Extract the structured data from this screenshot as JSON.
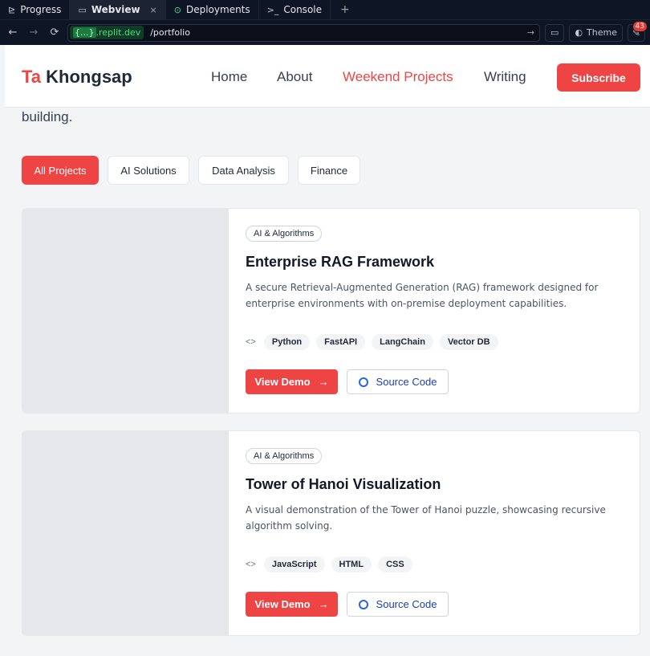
{
  "ide": {
    "tabs": [
      {
        "label": "Progress",
        "icon": "progress-icon"
      },
      {
        "label": "Webview",
        "icon": "monitor-icon"
      },
      {
        "label": "Deployments",
        "icon": "deploy-icon"
      },
      {
        "label": "Console",
        "icon": "terminal-icon"
      }
    ],
    "close_glyph": "×",
    "add_glyph": "+",
    "url": {
      "host_token": "{...}",
      "host": ".replit.dev",
      "path": "/portfolio"
    },
    "theme_label": "Theme",
    "notification_count": "43"
  },
  "site": {
    "logo_first": "Ta",
    "logo_last": "Khongsap",
    "nav": [
      "Home",
      "About",
      "Weekend Projects",
      "Writing"
    ],
    "subscribe_label": "Subscribe",
    "lead_text": "building.",
    "filters": [
      "All Projects",
      "AI Solutions",
      "Data Analysis",
      "Finance"
    ],
    "projects": [
      {
        "category": "AI & Algorithms",
        "title": "Enterprise RAG Framework",
        "description": "A secure Retrieval-Augmented Generation (RAG) framework designed for enterprise environments with on-premise deployment capabilities.",
        "tags": [
          "Python",
          "FastAPI",
          "LangChain",
          "Vector DB"
        ],
        "demo_label": "View Demo",
        "source_label": "Source Code"
      },
      {
        "category": "AI & Algorithms",
        "title": "Tower of Hanoi Visualization",
        "description": "A visual demonstration of the Tower of Hanoi puzzle, showcasing recursive algorithm solving.",
        "tags": [
          "JavaScript",
          "HTML",
          "CSS"
        ],
        "demo_label": "View Demo",
        "source_label": "Source Code"
      }
    ]
  },
  "colors": {
    "accent": "#ef4444",
    "ide_bg": "#0e1525",
    "link": "#1e40af"
  }
}
